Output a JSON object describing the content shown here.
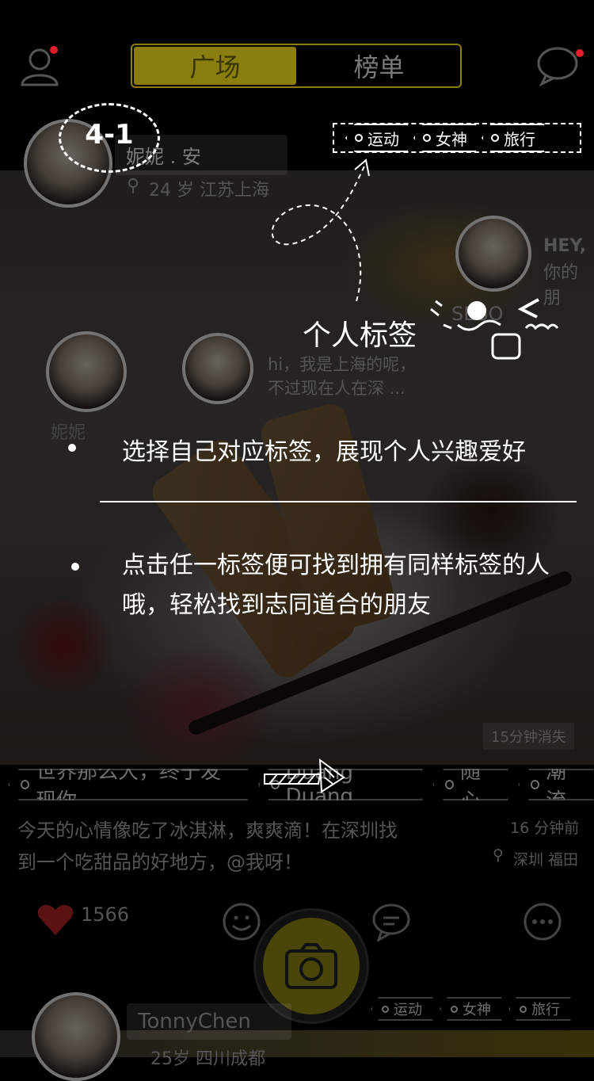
{
  "header": {
    "tabs": [
      {
        "label": "广场",
        "active": true
      },
      {
        "label": "榜单",
        "active": false
      }
    ],
    "user_icon": "user-icon",
    "chat_icon": "chat-bubble-icon",
    "accent": "#8a7e10",
    "notify_color": "#e0202a"
  },
  "profile_card": {
    "name": "妮妮 . 安",
    "age_location": "24 岁   江苏上海"
  },
  "right_profile": {
    "hey": "HEY,",
    "line2": "你的朋",
    "name": "SEBO"
  },
  "left_profile": {
    "name": "妮妮"
  },
  "post_comment": {
    "line1": "hi，我是上海的呢，",
    "line2": "不过现在人在深 ..."
  },
  "tutorial": {
    "step": "4-1",
    "title": "个人标签",
    "tags": [
      "运动",
      "女神",
      "旅行"
    ],
    "bullet1": "选择自己对应标签，展现个人兴趣爱好",
    "bullet2_line1": "点击任一标签便可找到拥有同样标签的人",
    "bullet2_line2": "哦，轻松找到志同道合的朋友"
  },
  "post": {
    "expire": "15分钟消失",
    "topics": [
      "世界那么大，终于发现你",
      "Duang Duang",
      "随心",
      "潮流"
    ],
    "text_line1": "今天的心情像吃了冰淇淋，爽爽滴！在深圳找",
    "text_line2": "到一个吃甜品的好地方，@我呀！",
    "time": "16 分钟前",
    "location": "深圳 福田",
    "likes": "1566"
  },
  "next_card": {
    "name": "TonnyChen",
    "age_location": "25岁   四川成都",
    "tags": [
      "运动",
      "女神",
      "旅行"
    ]
  }
}
